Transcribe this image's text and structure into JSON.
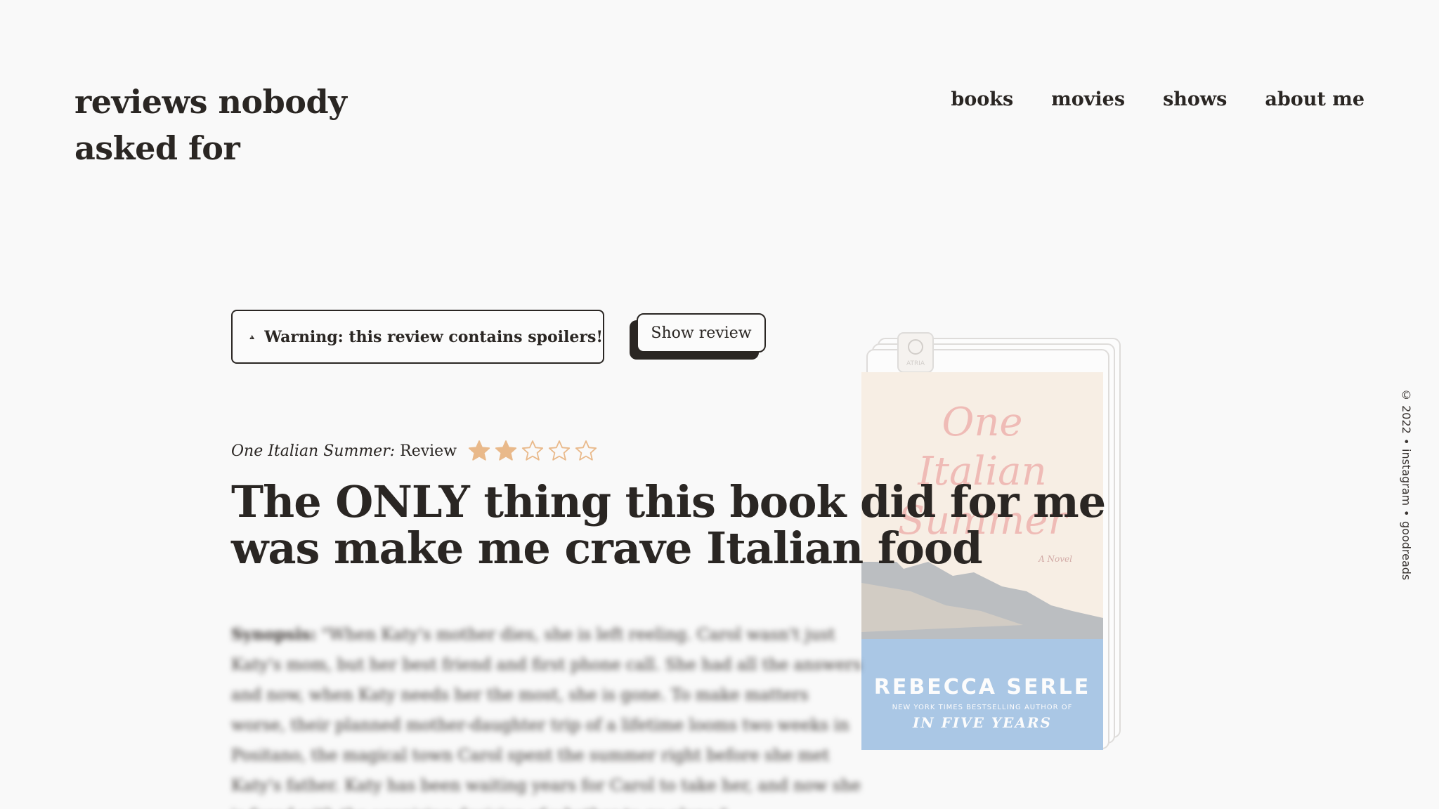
{
  "site": {
    "title": "reviews nobody asked for"
  },
  "nav": {
    "items": [
      "books",
      "movies",
      "shows",
      "about me"
    ]
  },
  "warning": {
    "icon": "warning-triangle-icon",
    "text": "Warning: this review contains spoilers!"
  },
  "show_review": {
    "label": "Show review"
  },
  "book_cover": {
    "title_line1": "One",
    "title_line2": "Italian",
    "title_line3": "Summer",
    "subtitle": "A Novel",
    "author": "REBECCA SERLE",
    "tagline": "NEW YORK TIMES BESTSELLING AUTHOR OF",
    "other_title": "IN FIVE YEARS",
    "publisher": "ATRIA"
  },
  "review": {
    "book_name": "One Italian Summer:",
    "label": " Review",
    "rating": 2,
    "max_rating": 5,
    "star_color": "#e9b98a",
    "headline": "The ONLY thing this book did for me was make me crave Italian food"
  },
  "synopsis": {
    "label": "Synopsis:",
    "text": " \"When Katy's mother dies, she is left reeling. Carol wasn't just Katy's mom, but her best friend and first phone call. She had all the answers and now, when Katy needs her the most, she is gone. To make matters worse, their planned mother-daughter trip of a lifetime looms two weeks in Positano, the magical town Carol spent the summer right before she met Katy's father. Katy has been waiting years for Carol to take her, and now she is faced with the agonizing decision of whether to go alone.\""
  },
  "footer": {
    "copyright": "© 2022",
    "sep": "•",
    "links": [
      "instagram",
      "goodreads"
    ]
  }
}
